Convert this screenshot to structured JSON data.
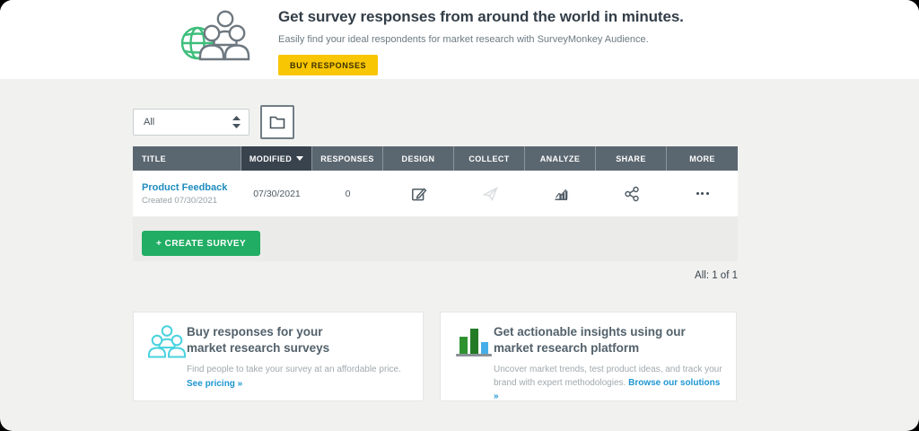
{
  "banner": {
    "title": "Get survey responses from around the world in minutes.",
    "subtitle": "Easily find your ideal respondents for market research with SurveyMonkey Audience.",
    "cta_label": "BUY RESPONSES"
  },
  "toolbar": {
    "filter_selected_value": "All"
  },
  "table": {
    "columns": [
      "TITLE",
      "MODIFIED",
      "RESPONSES",
      "DESIGN",
      "COLLECT",
      "ANALYZE",
      "SHARE",
      "MORE"
    ],
    "sorted_column": "MODIFIED",
    "sort_direction": "desc",
    "rows": [
      {
        "title": "Product Feedback",
        "created": "Created 07/30/2021",
        "modified": "07/30/2021",
        "responses": "0"
      }
    ]
  },
  "actions": {
    "create_survey_label": "+ CREATE SURVEY"
  },
  "pagination": {
    "count_label": "All: 1 of 1"
  },
  "cards": [
    {
      "title_line1": "Buy responses for your",
      "title_line2": "market research surveys",
      "body": "Find people to take your survey at an affordable price.",
      "link": "See pricing »"
    },
    {
      "title_line1": "Get actionable insights using our",
      "title_line2": "market research platform",
      "body": "Uncover market trends, test product ideas, and track your brand with expert methodologies.",
      "link": "Browse our solutions »"
    }
  ],
  "icons": {
    "banner": "globe-people-icon",
    "filter": "sort-arrows-icon",
    "folder": "folder-icon",
    "design": "edit-icon",
    "collect": "paper-plane-icon",
    "analyze": "bar-chart-icon",
    "share": "share-nodes-icon",
    "more": "ellipsis-icon",
    "card_buy": "people-group-icon",
    "card_insights": "color-bar-chart-icon"
  },
  "colors": {
    "accent_green": "#21AD64",
    "accent_yellow": "#F8C602",
    "globe_green": "#3DBE7B",
    "icon_teal": "#49D2DE",
    "link_blue": "#1E96D2",
    "title_link_blue": "#1E8CBE",
    "header_bg": "#5B6770",
    "header_sorted_bg": "#39434E",
    "page_bg": "#F1F2F0"
  }
}
